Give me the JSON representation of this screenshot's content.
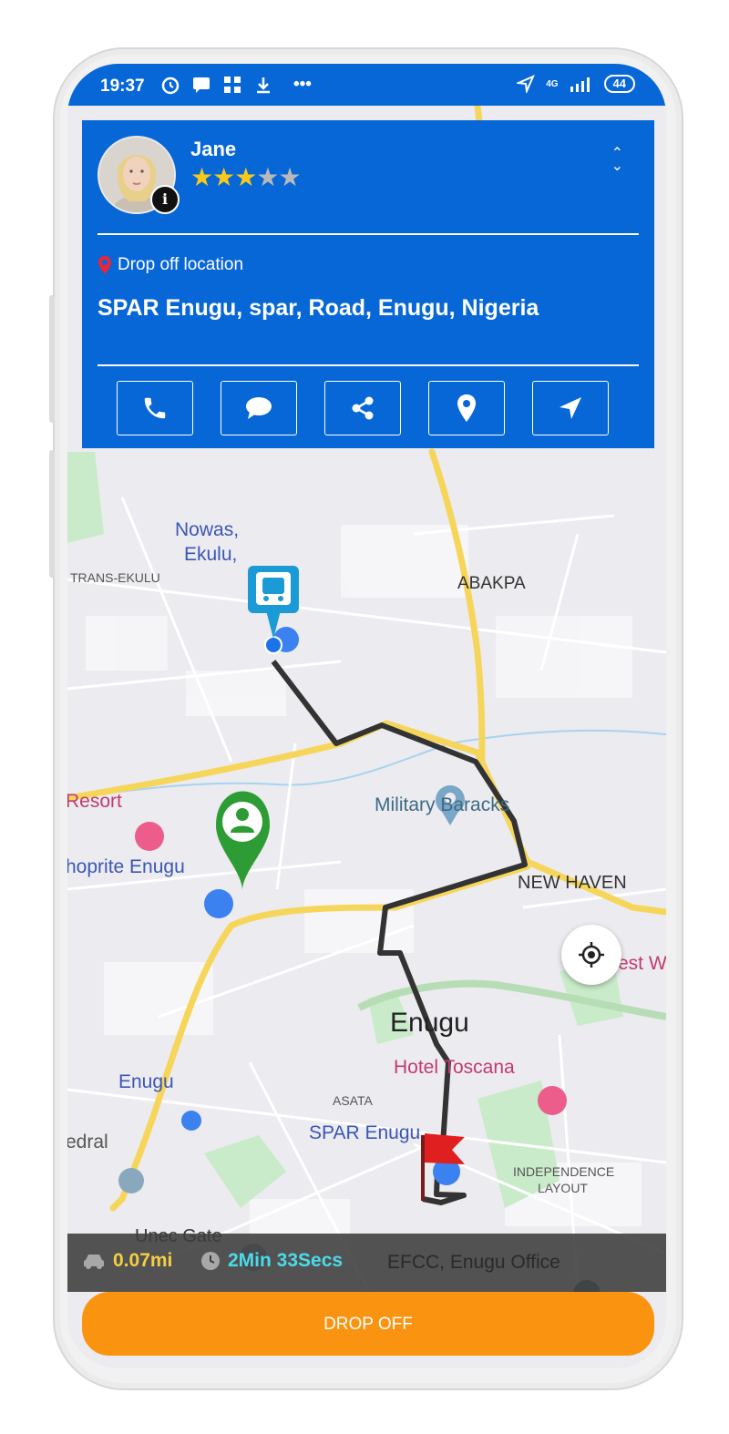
{
  "status_bar": {
    "time": "19:37",
    "network": "4G",
    "battery": "44"
  },
  "driver_card": {
    "name": "Jane",
    "rating": 3,
    "rating_max": 5,
    "drop_label": "Drop off location",
    "address": "SPAR Enugu, spar, Road, Enugu, Nigeria",
    "actions": [
      "phone-icon",
      "chat-icon",
      "share-icon",
      "location-pin-icon",
      "navigate-icon"
    ]
  },
  "map": {
    "labels": {
      "nowas": "Nowas,",
      "ekulu": "Ekulu,",
      "trans_ekulu": "TRANS-EKULU",
      "abakpa": "ABAKPA",
      "resort": "Resort",
      "military": "Military Baracks",
      "shoprite": "hoprite Enugu",
      "new_haven": "NEW HAVEN",
      "west": "est W",
      "enugu_city": "Enugu",
      "hotel": "Hotel Toscana",
      "enugu_station": "Enugu",
      "asata": "ASATA",
      "spar": "SPAR Enugu",
      "cathedral": "edral",
      "independence_1": "INDEPENDENCE",
      "independence_2": "LAYOUT",
      "unec": "Unec Gate",
      "efcc": "EFCC, Enugu Office"
    }
  },
  "trip": {
    "distance": "0.07mi",
    "eta": "2Min 33Secs"
  },
  "action_button": "DROP OFF",
  "colors": {
    "primary_blue": "#0767d6",
    "orange": "#fa9410",
    "distance_yellow": "#f5cf42",
    "eta_cyan": "#4ed9e8",
    "route": "#333333",
    "road_yellow": "#f6d65a",
    "pin_green": "#2e9c34"
  }
}
